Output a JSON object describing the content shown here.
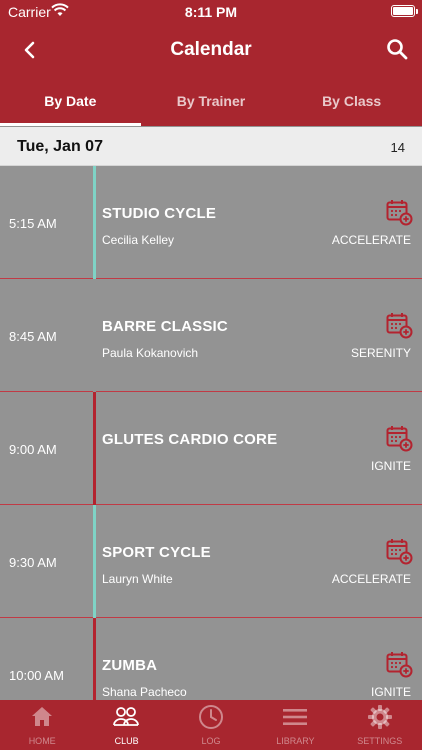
{
  "status_bar": {
    "carrier": "Carrier",
    "time": "8:11 PM"
  },
  "header": {
    "title": "Calendar",
    "back_icon": "chevron-left-icon",
    "search_icon": "search-icon"
  },
  "tabs": [
    {
      "label": "By Date",
      "active": true
    },
    {
      "label": "By Trainer",
      "active": false
    },
    {
      "label": "By Class",
      "active": false
    }
  ],
  "date_header": {
    "date": "Tue, Jan 07",
    "count": "14"
  },
  "classes": [
    {
      "time": "5:15 AM",
      "name": "STUDIO CYCLE",
      "trainer": "Cecilia Kelley",
      "category": "ACCELERATE",
      "accent_color": "#7fd3c6"
    },
    {
      "time": "8:45 AM",
      "name": "BARRE CLASSIC",
      "trainer": "Paula Kokanovich",
      "category": "SERENITY",
      "accent_color": "#939393"
    },
    {
      "time": "9:00 AM",
      "name": "GLUTES CARDIO CORE",
      "trainer": "",
      "category": "IGNITE",
      "accent_color": "#b3232f"
    },
    {
      "time": "9:30 AM",
      "name": "SPORT CYCLE",
      "trainer": "Lauryn White",
      "category": "ACCELERATE",
      "accent_color": "#7fd3c6"
    },
    {
      "time": "10:00 AM",
      "name": "ZUMBA",
      "trainer": "Shana Pacheco",
      "category": "IGNITE",
      "accent_color": "#b3232f"
    }
  ],
  "add_to_calendar_icon": "calendar-add-icon",
  "colors": {
    "brand": "#a8262f",
    "row_bg": "#939393",
    "divider": "#c03a45"
  },
  "bottom_nav": [
    {
      "label": "HOME",
      "icon": "home-icon",
      "active": false
    },
    {
      "label": "CLUB",
      "icon": "club-people-icon",
      "active": true
    },
    {
      "label": "LOG",
      "icon": "clock-icon",
      "active": false
    },
    {
      "label": "LIBRARY",
      "icon": "menu-lines-icon",
      "active": false
    },
    {
      "label": "SETTINGS",
      "icon": "gear-icon",
      "active": false
    }
  ]
}
